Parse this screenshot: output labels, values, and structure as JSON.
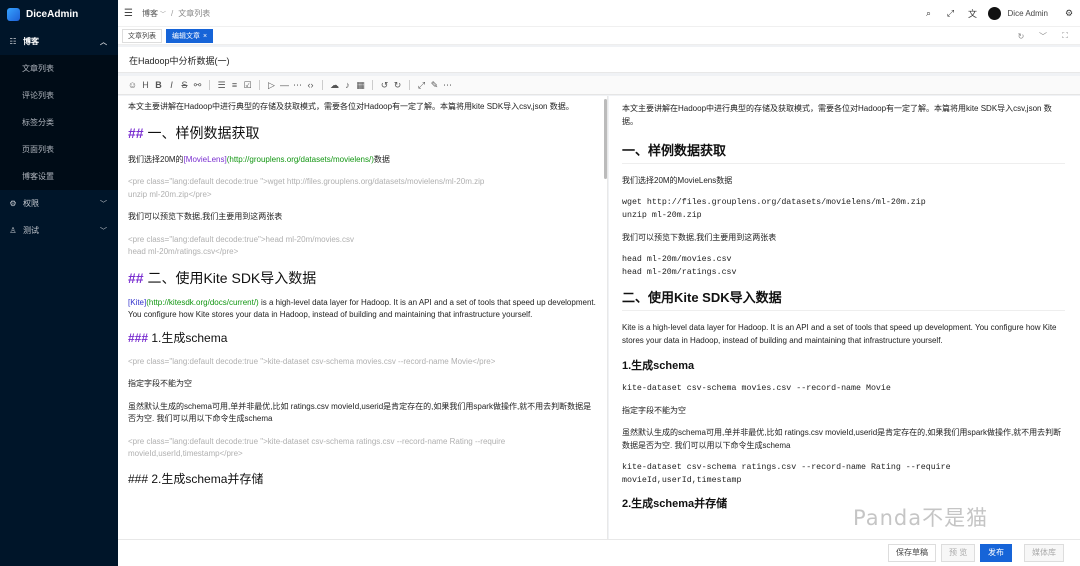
{
  "app": {
    "name": "DiceAdmin"
  },
  "sidebar": {
    "group_blog": "博客",
    "items": [
      "文章列表",
      "评论列表",
      "标签分类",
      "页面列表",
      "博客设置"
    ],
    "group_perm": "权限",
    "group_test": "测试"
  },
  "header": {
    "crumb_1": "博客",
    "crumb_2": "文章列表",
    "user": "Dice Admin"
  },
  "tabs": {
    "tab1": "文章列表",
    "tab2": "编辑文章",
    "close": "×"
  },
  "editor": {
    "title_value": "在Hadoop中分析数据(一)",
    "lines": {
      "intro": "本文主要讲解在Hadoop中进行典型的存储及获取模式，需要各位对Hadoop有一定了解。本篇将用kite SDK导入csv,json 数据。",
      "h2_1_hash": "##",
      "h2_1_text": " 一、样例数据获取",
      "p1_a": "我们选择20M的",
      "p1_link": "[MovieLens]",
      "p1_url": "(http://grouplens.org/datasets/movielens/)",
      "p1_b": "数据",
      "pre1": "<pre class=\"lang:default decode:true \">wget http://files.grouplens.org/datasets/movielens/ml-20m.zip",
      "pre1b": "unzip ml-20m.zip</pre>",
      "p2": "我们可以预览下数据,我们主要用到这两张表",
      "pre2": "<pre class=\"lang:default decode:true\">head ml-20m/movies.csv",
      "pre2b": "head ml-20m/ratings.csv</pre>",
      "h2_2_hash": "##",
      "h2_2_text": " 二、使用Kite SDK导入数据",
      "p3_link": "[Kite]",
      "p3_url": "(http://kitesdk.org/docs/current/)",
      "p3_b": " is a high-level data layer for Hadoop. It is an API and a set of tools that speed up development. You configure how Kite stores your data in Hadoop, instead of building and maintaining that infrastructure yourself.",
      "h3_1_hash": "###",
      "h3_1_text": " 1.生成schema",
      "pre3": "<pre class=\"lang:default decode:true \">kite-dataset csv-schema movies.csv --record-name Movie</pre>",
      "p4": "指定字段不能为空",
      "p5": "虽然默认生成的schema可用,单并非最优,比如 ratings.csv  movieId,userid是肯定存在的,如果我们用spark做操作,就不用去判断数据是否为空. 我们可以用以下命令生成schema",
      "pre4": "<pre class=\"lang:default decode:true \">kite-dataset csv-schema ratings.csv --record-name Rating --require movieId,userId,timestamp</pre>",
      "h3_2": "### 2.生成schema并存储"
    }
  },
  "preview": {
    "intro": "本文主要讲解在Hadoop中进行典型的存储及获取模式，需要各位对Hadoop有一定了解。本篇将用kite SDK导入csv,json 数据。",
    "h2_1": "一、样例数据获取",
    "p1": "我们选择20M的MovieLens数据",
    "code1a": "wget http://files.grouplens.org/datasets/movielens/ml-20m.zip",
    "code1b": "unzip ml-20m.zip",
    "p2": "我们可以预览下数据,我们主要用到这两张表",
    "code2a": "head ml-20m/movies.csv",
    "code2b": "head ml-20m/ratings.csv",
    "h2_2": "二、使用Kite SDK导入数据",
    "p3": "Kite is a high-level data layer for Hadoop. It is an API and a set of tools that speed up development. You configure how Kite stores your data in Hadoop, instead of building and maintaining that infrastructure yourself.",
    "h3_1": "1.生成schema",
    "code3": "kite-dataset csv-schema movies.csv --record-name Movie",
    "p4": "指定字段不能为空",
    "p5": "虽然默认生成的schema可用,单并非最优,比如 ratings.csv movieId,userid是肯定存在的,如果我们用spark做操作,就不用去判断数据是否为空. 我们可以用以下命令生成schema",
    "code4": "kite-dataset csv-schema ratings.csv --record-name Rating --require movieId,userId,timestamp",
    "h3_2": "2.生成schema并存储"
  },
  "footer": {
    "save_draft": "保存草稿",
    "preview": "预 览",
    "publish": "发布",
    "media": "媒体库"
  },
  "watermark": "Panda不是猫",
  "colors": {
    "sidebar_bg": "#001529",
    "primary": "#1664d8"
  }
}
